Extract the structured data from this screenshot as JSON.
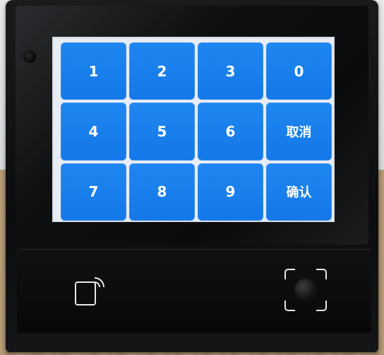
{
  "keypad": {
    "keys": [
      "1",
      "2",
      "3",
      "0",
      "4",
      "5",
      "6",
      "取消",
      "7",
      "8",
      "9",
      "确认"
    ]
  },
  "colors": {
    "key_blue": "#1a80ee",
    "screen_bg": "#e8ecf4",
    "device_black": "#0c0d0e"
  },
  "icons": {
    "nfc": "nfc-card-reader-icon",
    "fingerprint": "fingerprint-sensor-icon"
  }
}
